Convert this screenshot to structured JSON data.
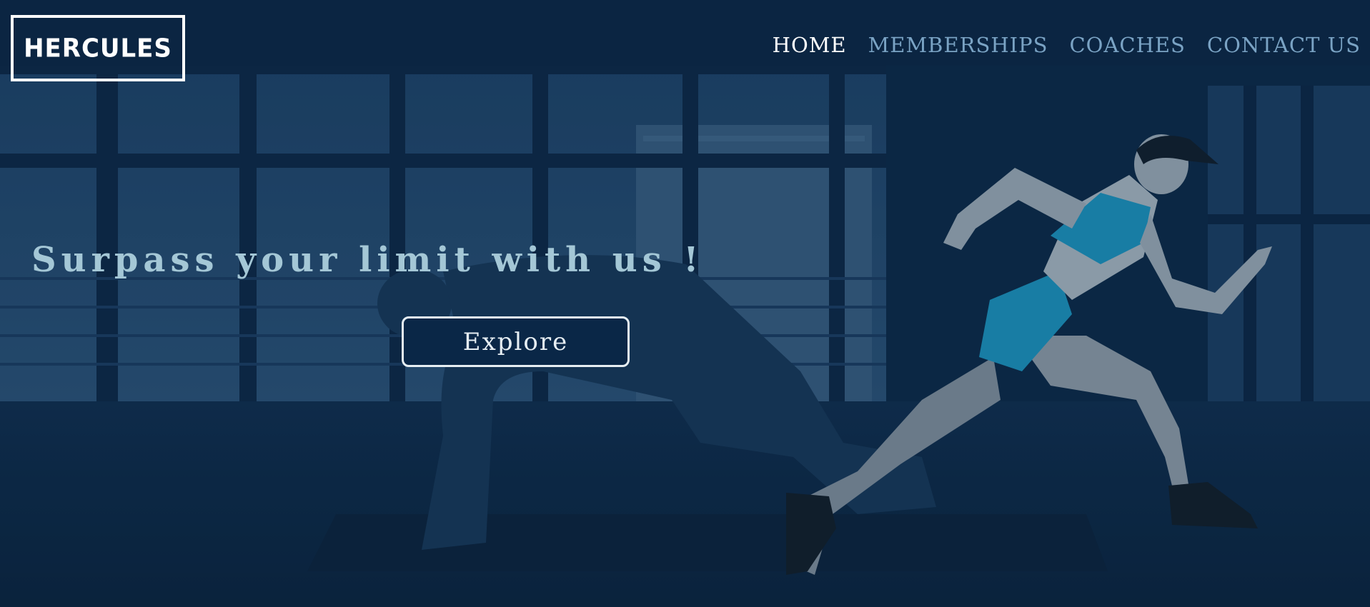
{
  "brand": {
    "logo_text": "HERCULES"
  },
  "nav": {
    "items": [
      {
        "label": "HOME",
        "active": true
      },
      {
        "label": "MEMBERSHIPS",
        "active": false
      },
      {
        "label": "COACHES",
        "active": false
      },
      {
        "label": "CONTACT US",
        "active": false
      }
    ]
  },
  "hero": {
    "headline": "Surpass your limit with us !",
    "cta_label": "Explore"
  },
  "colors": {
    "background": "#0b2440",
    "nav_active": "#ffffff",
    "nav_inactive": "#7aa3c4",
    "headline": "#a4c7d6",
    "accent_teal": "#1b8fb8"
  }
}
